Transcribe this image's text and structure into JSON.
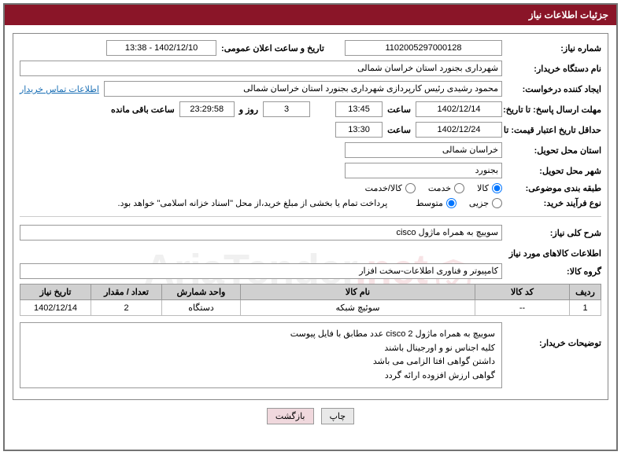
{
  "header": {
    "title": "جزئیات اطلاعات نیاز"
  },
  "fields": {
    "need_no_lbl": "شماره نیاز:",
    "need_no": "1102005297000128",
    "announce_lbl": "تاریخ و ساعت اعلان عمومی:",
    "announce_val": "1402/12/10 - 13:38",
    "buyer_org_lbl": "نام دستگاه خریدار:",
    "buyer_org": "شهرداری بجنورد استان خراسان شمالی",
    "requester_lbl": "ایجاد کننده درخواست:",
    "requester": "محمود رشیدی رئیس کارپردازی شهرداری بجنورد استان خراسان شمالی",
    "contact_link": "اطلاعات تماس خریدار",
    "deadline_send_lbl": "مهلت ارسال پاسخ: تا تاریخ:",
    "deadline_send_date": "1402/12/14",
    "hour_lbl": "ساعت",
    "deadline_send_time": "13:45",
    "days_val": "3",
    "days_lbl": "روز و",
    "remain_time": "23:29:58",
    "remain_lbl": "ساعت باقی مانده",
    "validity_lbl": "حداقل تاریخ اعتبار قیمت: تا تاریخ:",
    "validity_date": "1402/12/24",
    "validity_time": "13:30",
    "province_lbl": "استان محل تحویل:",
    "province": "خراسان شمالی",
    "city_lbl": "شهر محل تحویل:",
    "city": "بجنورد",
    "class_lbl": "طبقه بندی موضوعی:",
    "class_goods": "کالا",
    "class_service": "خدمت",
    "class_both": "کالا/خدمت",
    "process_lbl": "نوع فرآیند خرید:",
    "process_partial": "جزیی",
    "process_medium": "متوسط",
    "process_note": "پرداخت تمام یا بخشی از مبلغ خرید،از محل \"اسناد خزانه اسلامی\" خواهد بود.",
    "desc_lbl": "شرح کلی نیاز:",
    "desc_val": "سوییچ به همراه ماژول cisco",
    "goods_info_title": "اطلاعات کالاهای مورد نیاز",
    "group_lbl": "گروه کالا:",
    "group_val": "کامپیوتر و فناوری اطلاعات-سخت افزار",
    "buyer_notes_lbl": "توضیحات خریدار:",
    "buyer_notes_l1": "سوییچ به همراه ماژول  cisco 2 عدد مطابق با فایل پیوست",
    "buyer_notes_l2": "کلیه اجناس نو و اورجینال باشند",
    "buyer_notes_l3": "داشتن گواهی افتا الزامی می باشد",
    "buyer_notes_l4": "گواهی ارزش افزوده ارائه گردد"
  },
  "table": {
    "headers": {
      "row": "ردیف",
      "code": "کد کالا",
      "name": "نام کالا",
      "unit": "واحد شمارش",
      "qty": "تعداد / مقدار",
      "date": "تاریخ نیاز"
    },
    "rows": [
      {
        "row": "1",
        "code": "--",
        "name": "سوئیچ شبکه",
        "unit": "دستگاه",
        "qty": "2",
        "date": "1402/12/14"
      }
    ]
  },
  "buttons": {
    "print": "چاپ",
    "back": "بازگشت"
  },
  "watermark": {
    "text_a": "AriaTender",
    "text_b": ".net"
  }
}
